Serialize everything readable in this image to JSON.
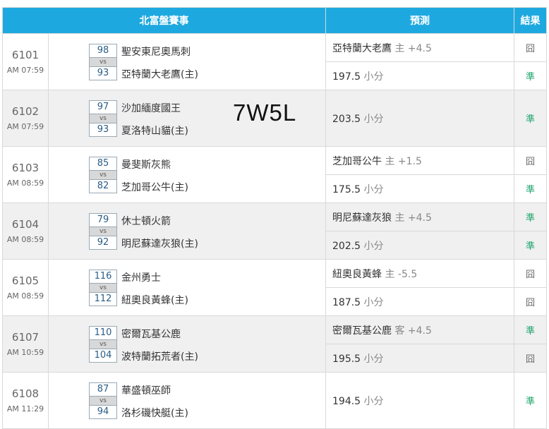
{
  "header": {
    "title": "北富盤賽事",
    "prediction": "預測",
    "result": "結果"
  },
  "record_text": "7W5L",
  "games": [
    {
      "code": "6101",
      "time": "AM 07:59",
      "away": {
        "name": "聖安東尼奧馬刺",
        "score": "98"
      },
      "home": {
        "name": "亞特蘭大老鷹(主)",
        "score": "93"
      },
      "vs": "vs",
      "predictions": [
        {
          "pick": "亞特蘭大老鷹",
          "side": "主",
          "line": "+4.5",
          "result": "囧",
          "outcome": "lose"
        },
        {
          "pick": "197.5",
          "side": "小分",
          "line": "",
          "result": "準",
          "outcome": "win"
        }
      ]
    },
    {
      "code": "6102",
      "time": "AM 07:59",
      "away": {
        "name": "沙加緬度國王",
        "score": "97"
      },
      "home": {
        "name": "夏洛特山貓(主)",
        "score": "93"
      },
      "vs": "vs",
      "predictions": [
        {
          "pick": "203.5",
          "side": "小分",
          "line": "",
          "result": "準",
          "outcome": "win"
        }
      ]
    },
    {
      "code": "6103",
      "time": "AM 08:59",
      "away": {
        "name": "曼斐斯灰熊",
        "score": "85"
      },
      "home": {
        "name": "芝加哥公牛(主)",
        "score": "82"
      },
      "vs": "vs",
      "predictions": [
        {
          "pick": "芝加哥公牛",
          "side": "主",
          "line": "+1.5",
          "result": "囧",
          "outcome": "lose"
        },
        {
          "pick": "175.5",
          "side": "小分",
          "line": "",
          "result": "準",
          "outcome": "win"
        }
      ]
    },
    {
      "code": "6104",
      "time": "AM 08:59",
      "away": {
        "name": "休士頓火箭",
        "score": "79"
      },
      "home": {
        "name": "明尼蘇達灰狼(主)",
        "score": "92"
      },
      "vs": "vs",
      "predictions": [
        {
          "pick": "明尼蘇達灰狼",
          "side": "主",
          "line": "+4.5",
          "result": "準",
          "outcome": "win"
        },
        {
          "pick": "202.5",
          "side": "小分",
          "line": "",
          "result": "準",
          "outcome": "win"
        }
      ]
    },
    {
      "code": "6105",
      "time": "AM 08:59",
      "away": {
        "name": "金州勇士",
        "score": "116"
      },
      "home": {
        "name": "紐奧良黃蜂(主)",
        "score": "112"
      },
      "vs": "vs",
      "predictions": [
        {
          "pick": "紐奧良黃蜂",
          "side": "主",
          "line": "-5.5",
          "result": "囧",
          "outcome": "lose"
        },
        {
          "pick": "187.5",
          "side": "小分",
          "line": "",
          "result": "囧",
          "outcome": "lose"
        }
      ]
    },
    {
      "code": "6107",
      "time": "AM 10:59",
      "away": {
        "name": "密爾瓦基公鹿",
        "score": "110"
      },
      "home": {
        "name": "波特蘭拓荒者(主)",
        "score": "104"
      },
      "vs": "vs",
      "predictions": [
        {
          "pick": "密爾瓦基公鹿",
          "side": "客",
          "line": "+4.5",
          "result": "準",
          "outcome": "win"
        },
        {
          "pick": "195.5",
          "side": "小分",
          "line": "",
          "result": "囧",
          "outcome": "lose"
        }
      ]
    },
    {
      "code": "6108",
      "time": "AM 11:29",
      "away": {
        "name": "華盛頓巫師",
        "score": "87"
      },
      "home": {
        "name": "洛杉磯快艇(主)",
        "score": "94"
      },
      "vs": "vs",
      "predictions": [
        {
          "pick": "194.5",
          "side": "小分",
          "line": "",
          "result": "準",
          "outcome": "win"
        }
      ]
    }
  ]
}
